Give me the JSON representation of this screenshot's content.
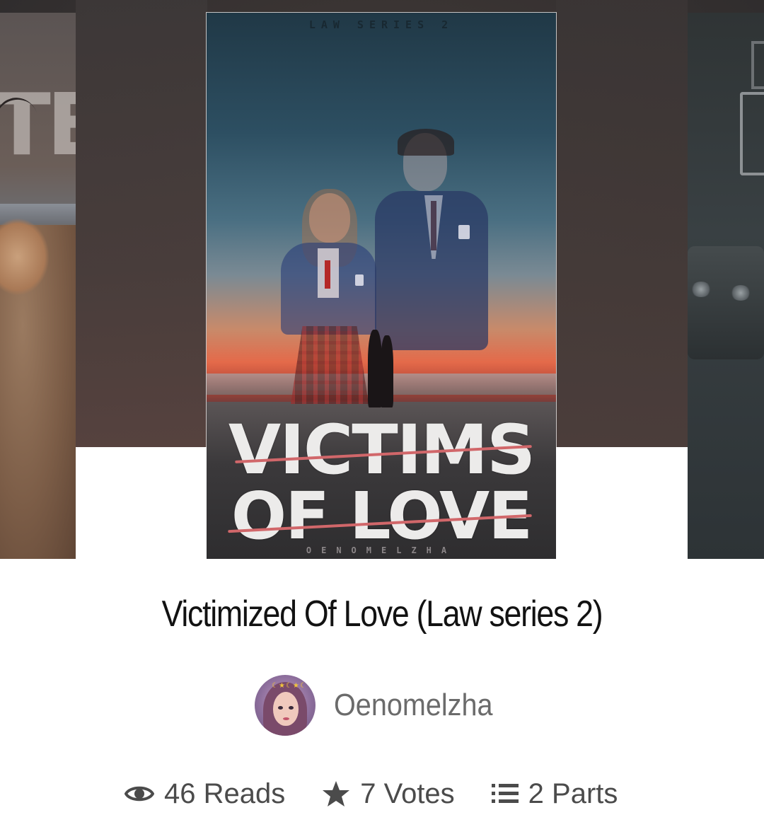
{
  "carousel": {
    "main_cover": {
      "series_text": "LAW SERIES 2",
      "title_line_1": "VICTIMS",
      "title_line_2": "OF LOVE",
      "author_text": "OENOMELZHA"
    }
  },
  "story": {
    "title": "Victimized Of Love (Law series 2)",
    "author": "Oenomelzha"
  },
  "stats": {
    "reads": "46 Reads",
    "votes": "7 Votes",
    "parts": "2 Parts"
  },
  "icons": {
    "reads": "eye-icon",
    "votes": "star-icon",
    "parts": "list-icon"
  },
  "colors": {
    "title_text": "#121212",
    "author_text": "#6b6b6b",
    "stats_text": "#4b4b4b",
    "cover_script_accent": "#d1676a"
  }
}
